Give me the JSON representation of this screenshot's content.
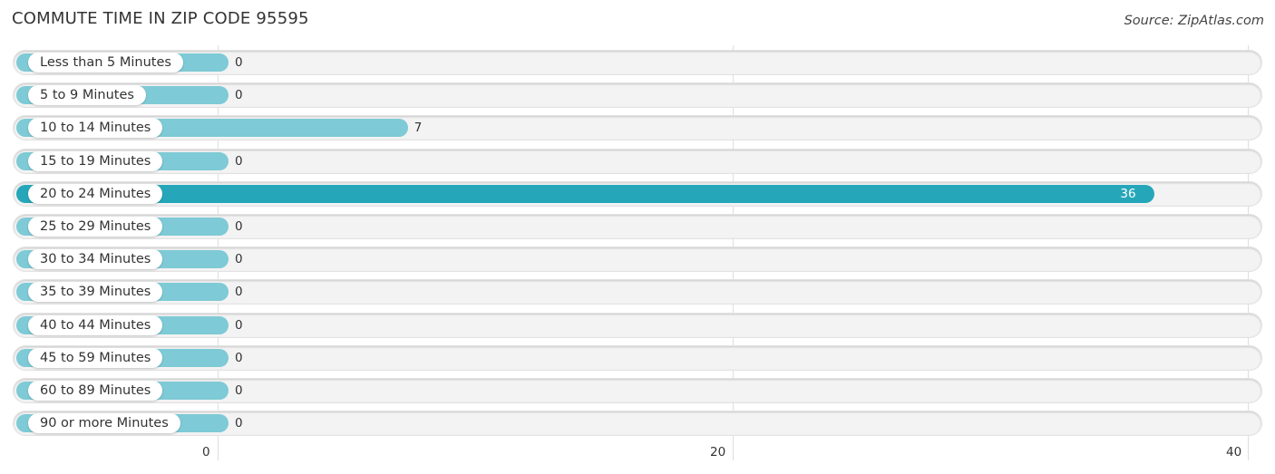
{
  "header": {
    "title": "COMMUTE TIME IN ZIP CODE 95595",
    "source": "Source: ZipAtlas.com"
  },
  "colors": {
    "bar_normal": "#7ecad6",
    "bar_highlight": "#26a7b9",
    "track": "#f3f3f3"
  },
  "chart_data": {
    "type": "bar",
    "orientation": "horizontal",
    "title": "COMMUTE TIME IN ZIP CODE 95595",
    "xlabel": "",
    "ylabel": "",
    "xlim": [
      0,
      40
    ],
    "xticks": [
      "0",
      "20",
      "40"
    ],
    "grid": true,
    "categories": [
      "Less than 5 Minutes",
      "5 to 9 Minutes",
      "10 to 14 Minutes",
      "15 to 19 Minutes",
      "20 to 24 Minutes",
      "25 to 29 Minutes",
      "30 to 34 Minutes",
      "35 to 39 Minutes",
      "40 to 44 Minutes",
      "45 to 59 Minutes",
      "60 to 89 Minutes",
      "90 or more Minutes"
    ],
    "values": [
      0,
      0,
      7,
      0,
      36,
      0,
      0,
      0,
      0,
      0,
      0,
      0
    ],
    "value_labels": [
      "0",
      "0",
      "7",
      "0",
      "36",
      "0",
      "0",
      "0",
      "0",
      "0",
      "0",
      "0"
    ],
    "highlight_index": 4
  }
}
